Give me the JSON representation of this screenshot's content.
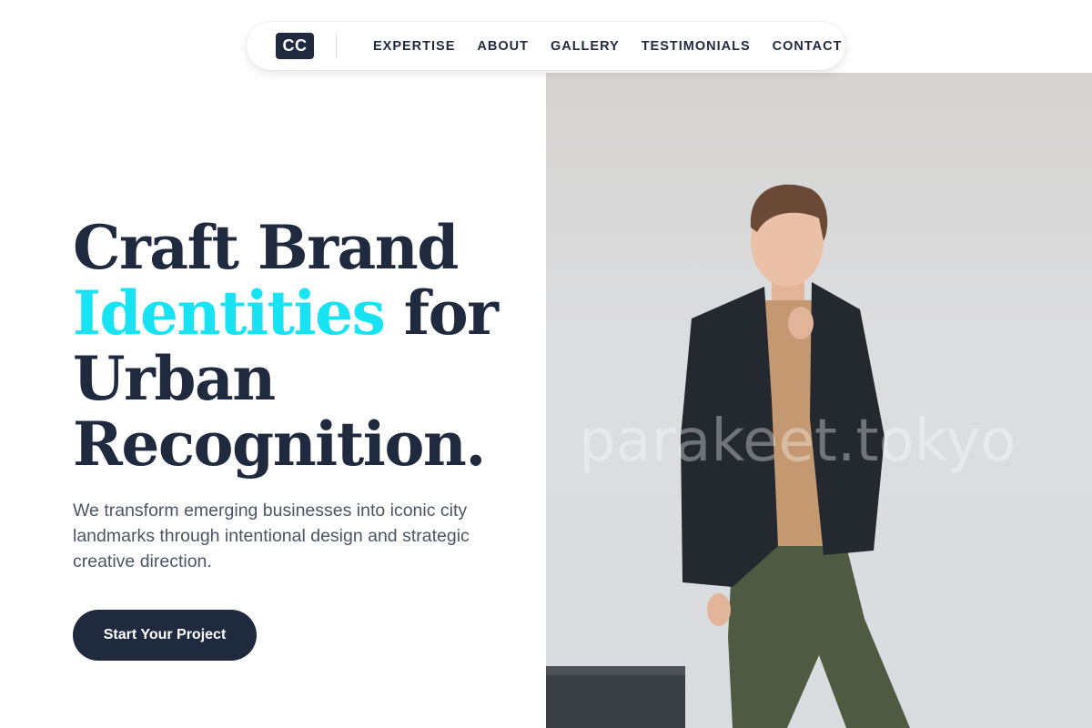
{
  "nav": {
    "logo": "CC",
    "links": [
      "EXPERTISE",
      "ABOUT",
      "GALLERY",
      "TESTIMONIALS",
      "CONTACT"
    ]
  },
  "hero": {
    "headline": {
      "line1": "Craft Brand",
      "accent": "Identities",
      "line2_rest": " for",
      "line3": "Urban",
      "line4": "Recognition."
    },
    "subtitle": "We transform emerging businesses into iconic city landmarks through intentional design and strategic creative direction.",
    "cta_label": "Start Your Project",
    "image_watermark": "parakeet.tokyo"
  },
  "colors": {
    "primary": "#1f2a3f",
    "accent": "#17e3f2",
    "body_text": "#4b5563"
  }
}
